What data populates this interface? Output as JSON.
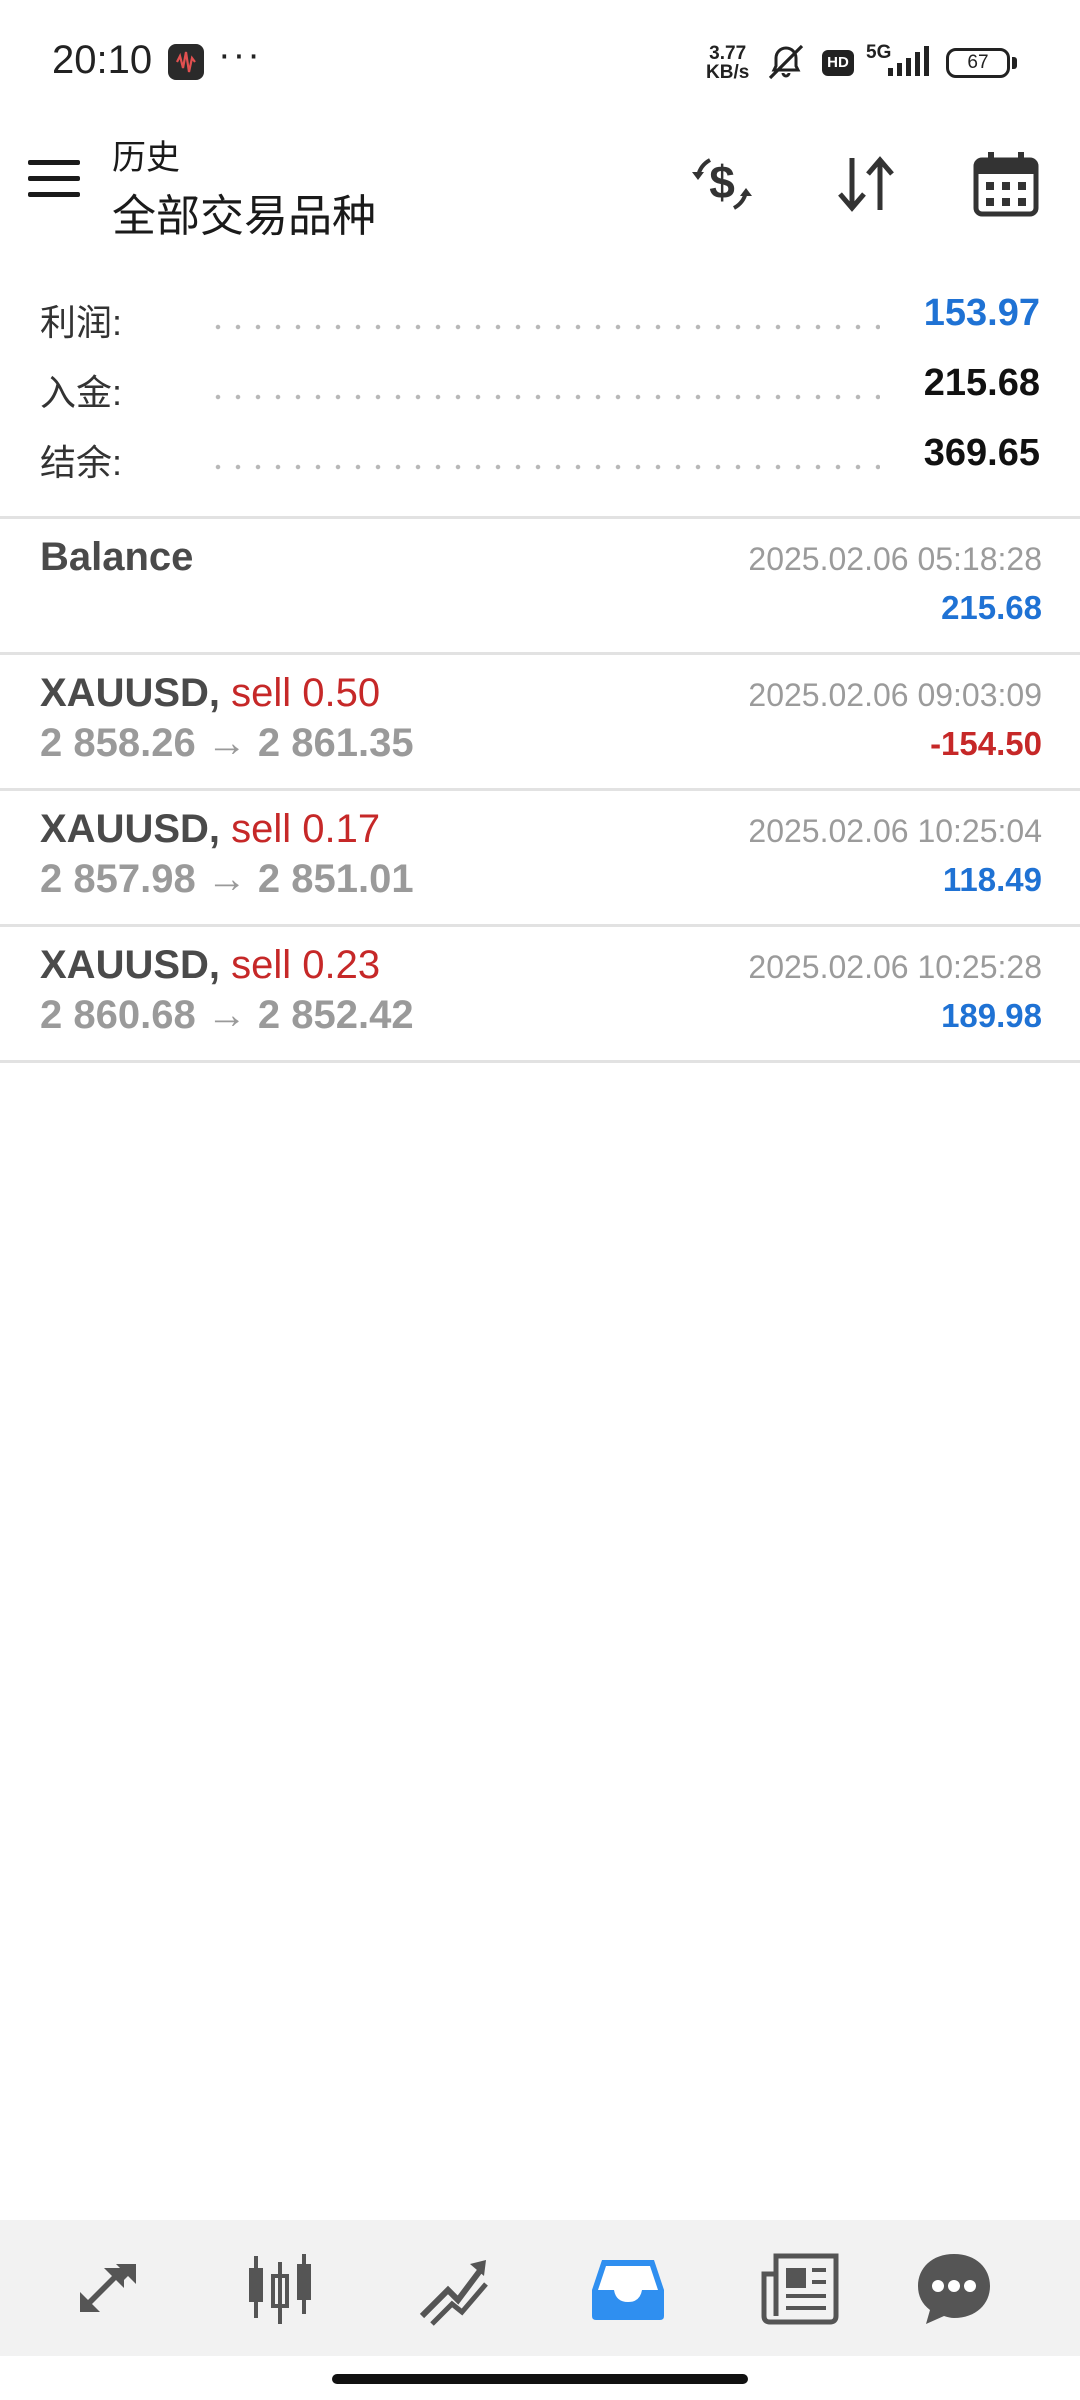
{
  "status": {
    "time": "20:10",
    "more": "···",
    "net_speed_value": "3.77",
    "net_speed_unit": "KB/s",
    "hd": "HD",
    "network": "5G",
    "battery": "67"
  },
  "header": {
    "subtitle": "历史",
    "title": "全部交易品种",
    "icons": [
      "menu-icon",
      "currency-exchange-icon",
      "sort-icon",
      "calendar-icon"
    ]
  },
  "summary": {
    "profit_label": "利润:",
    "profit_value": "153.97",
    "deposit_label": "入金:",
    "deposit_value": "215.68",
    "balance_label": "结余:",
    "balance_value": "369.65"
  },
  "deals": [
    {
      "name": "Balance",
      "time": "2025.02.06 05:18:28",
      "profit": "215.68"
    },
    {
      "symbol": "XAUUSD",
      "sep": ",",
      "side": "sell 0.50",
      "prices": "2 858.26 → 2 861.35",
      "time": "2025.02.06 09:03:09",
      "profit": "-154.50"
    },
    {
      "symbol": "XAUUSD",
      "sep": ",",
      "side": "sell 0.17",
      "prices": "2 857.98 → 2 851.01",
      "time": "2025.02.06 10:25:04",
      "profit": "118.49"
    },
    {
      "symbol": "XAUUSD",
      "sep": ",",
      "side": "sell 0.23",
      "prices": "2 860.68 → 2 852.42",
      "time": "2025.02.06 10:25:28",
      "profit": "189.98"
    }
  ],
  "colors": {
    "positive": "#1f72d4",
    "negative": "#c62828",
    "accent_active_tab": "#2f8ff0"
  },
  "bottom_nav": [
    "quotes-icon",
    "chart-icon",
    "trade-icon",
    "history-icon",
    "news-icon",
    "chat-icon"
  ],
  "active_tab": "history-icon"
}
